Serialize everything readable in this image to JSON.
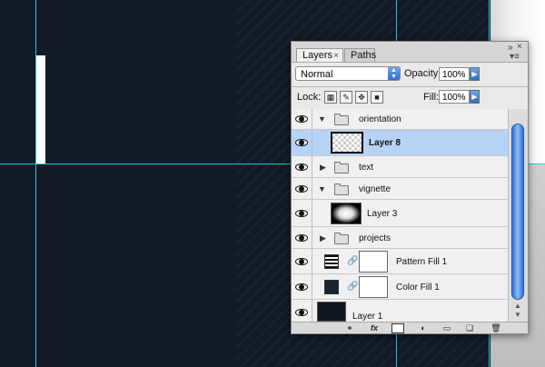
{
  "panel": {
    "tabs": [
      {
        "label": "Layers",
        "close": "×"
      },
      {
        "label": "Paths"
      }
    ],
    "collapse_glyph": "»",
    "close_glyph": "×",
    "menu_glyph": "▾≡"
  },
  "options": {
    "blend_mode": "Normal",
    "opacity_label": "Opacity:",
    "opacity_value": "100%",
    "lock_label": "Lock:",
    "fill_label": "Fill:",
    "fill_value": "100%",
    "lock_icons": [
      "lock-transparent-icon",
      "lock-paint-icon",
      "lock-move-icon",
      "lock-all-icon"
    ]
  },
  "layers": [
    {
      "name": "orientation",
      "type": "group",
      "expanded": true,
      "visible": true
    },
    {
      "name": "Layer 8",
      "type": "layer",
      "selected": true,
      "visible": true,
      "thumb": "checker"
    },
    {
      "name": "text",
      "type": "group",
      "expanded": false,
      "visible": true
    },
    {
      "name": "vignette",
      "type": "group",
      "expanded": true,
      "visible": true
    },
    {
      "name": "Layer 3",
      "type": "layer",
      "visible": true,
      "thumb": "vignette"
    },
    {
      "name": "projects",
      "type": "group",
      "expanded": false,
      "visible": true
    },
    {
      "name": "Pattern Fill 1",
      "type": "fill",
      "visible": true,
      "thumb": "pattern"
    },
    {
      "name": "Color Fill 1",
      "type": "fill",
      "visible": true,
      "thumb": "color",
      "color": "#1a2231"
    },
    {
      "name": "Layer 1",
      "type": "layer",
      "visible": true,
      "thumb": "dark"
    }
  ],
  "bottom_icons": [
    "link-layers-icon",
    "fx-icon",
    "mask-icon",
    "adjustment-icon",
    "new-group-icon",
    "new-layer-icon",
    "trash-icon"
  ],
  "bottom_labels": {
    "fx": "fx"
  },
  "colors": {
    "canvas": "#121a27",
    "guide": "#29c7d6",
    "selection": "#b6d3f6",
    "accent": "#2f6fd1"
  }
}
